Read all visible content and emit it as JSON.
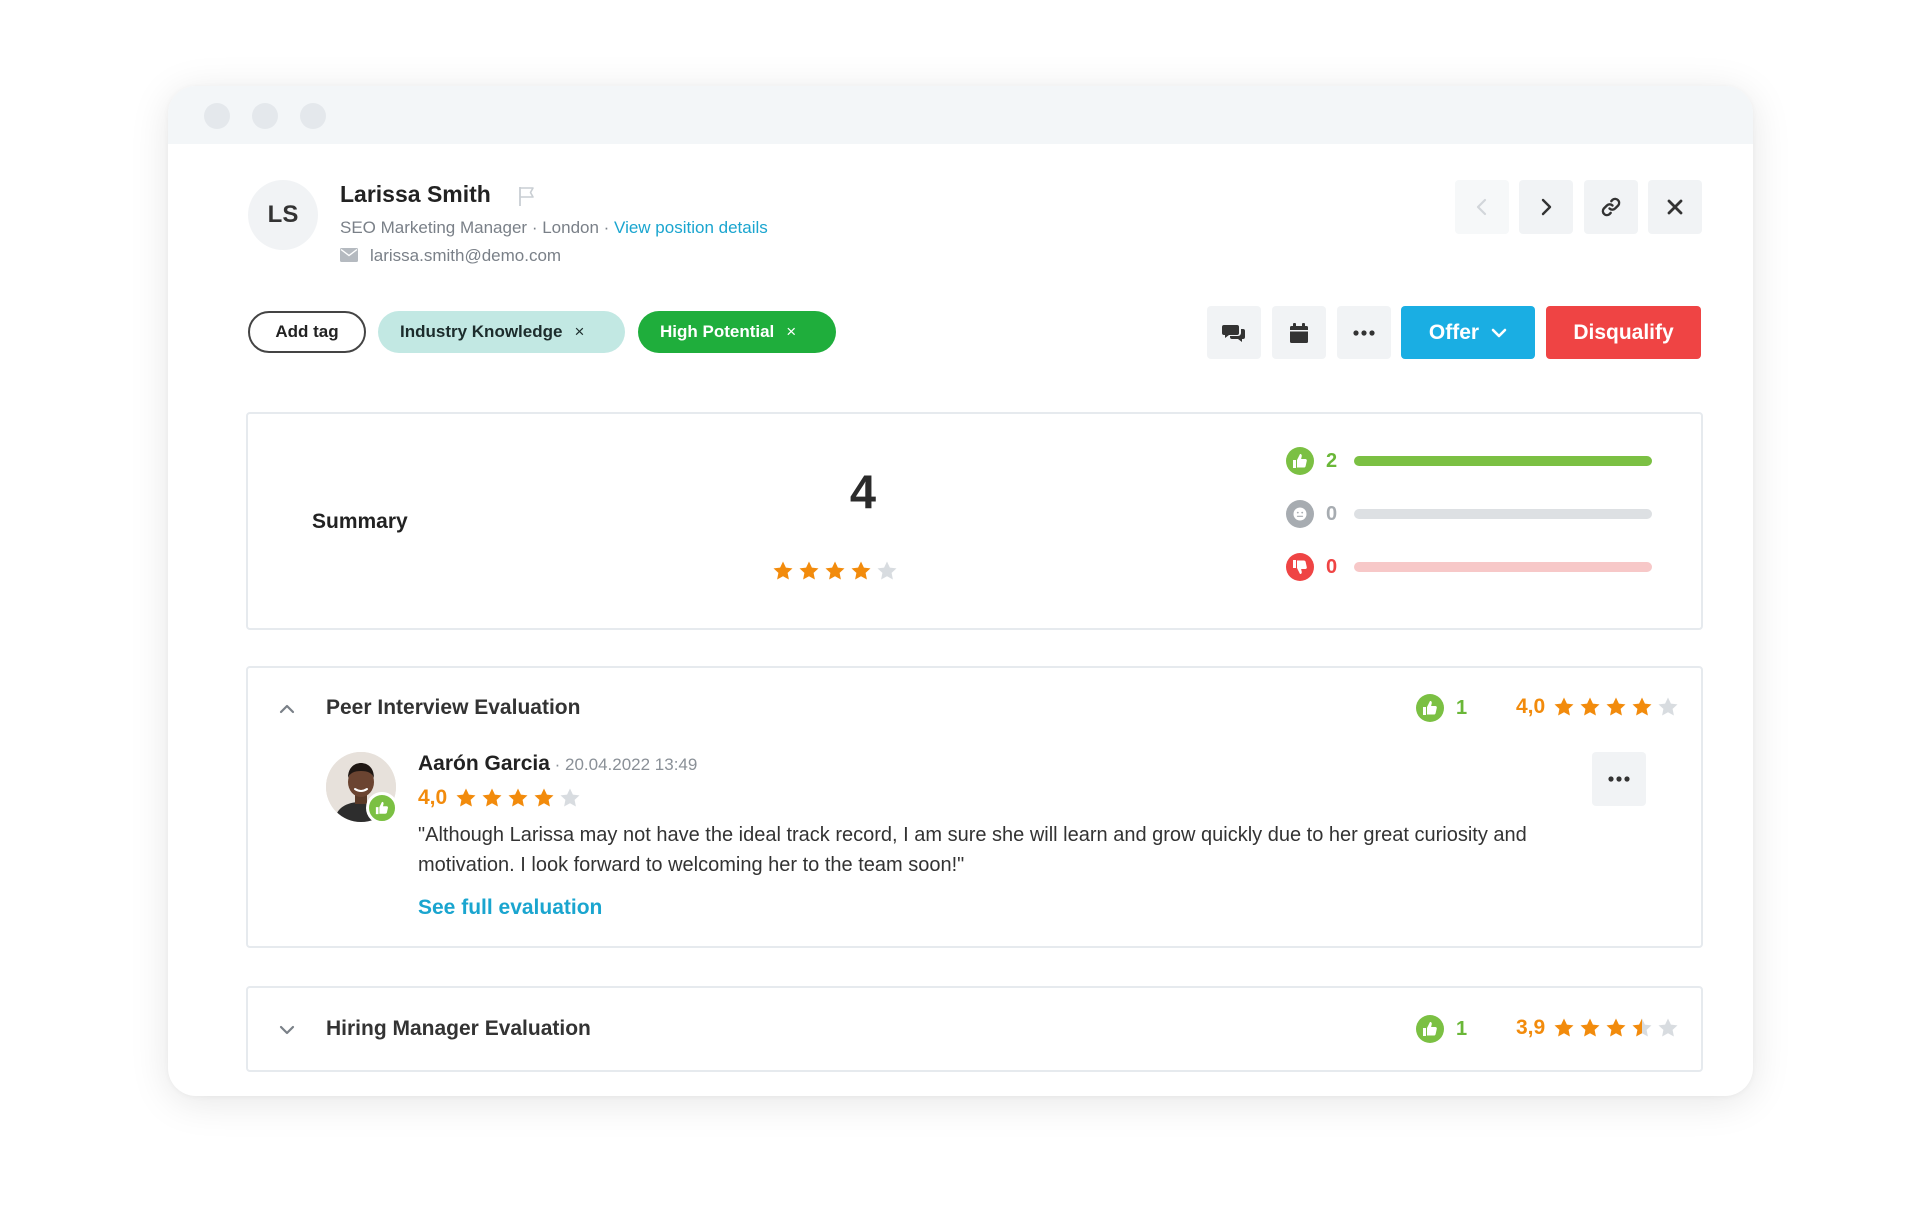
{
  "candidate": {
    "initials": "LS",
    "name": "Larissa Smith",
    "position": "SEO Marketing Manager",
    "location": "London",
    "separator": " · ",
    "view_position_link": "View position details",
    "email": "larissa.smith@demo.com"
  },
  "tags": {
    "add_label": "Add tag",
    "items": [
      {
        "label": "Industry Knowledge",
        "remove": "×"
      },
      {
        "label": "High Potential",
        "remove": "×"
      }
    ]
  },
  "actions": {
    "offer_label": "Offer",
    "disqualify_label": "Disqualify"
  },
  "summary": {
    "label": "Summary",
    "score": "4",
    "stars_filled": 4,
    "stars_total": 5,
    "votes": {
      "positive": "2",
      "neutral": "0",
      "negative": "0"
    }
  },
  "evaluations": [
    {
      "title": "Peer Interview Evaluation",
      "expanded": true,
      "vote_count": "1",
      "rating": "4,0",
      "stars": 4.0,
      "review": {
        "reviewer": "Aarón Garcia",
        "date": " · 20.04.2022 13:49",
        "rating": "4,0",
        "stars": 4.0,
        "text": "\"Although Larissa may not have the ideal track record, I am sure she will learn and grow quickly due to her great curiosity and motivation. I look forward to welcoming her to the team soon!\"",
        "link": "See full evaluation"
      }
    },
    {
      "title": "Hiring Manager Evaluation",
      "expanded": false,
      "vote_count": "1",
      "rating": "3,9",
      "stars": 3.5
    }
  ],
  "colors": {
    "accent": "#1aaee3",
    "danger": "#ef4444",
    "positive": "#6ab738",
    "star": "#f28b0c",
    "star_empty": "#d8dce0"
  }
}
